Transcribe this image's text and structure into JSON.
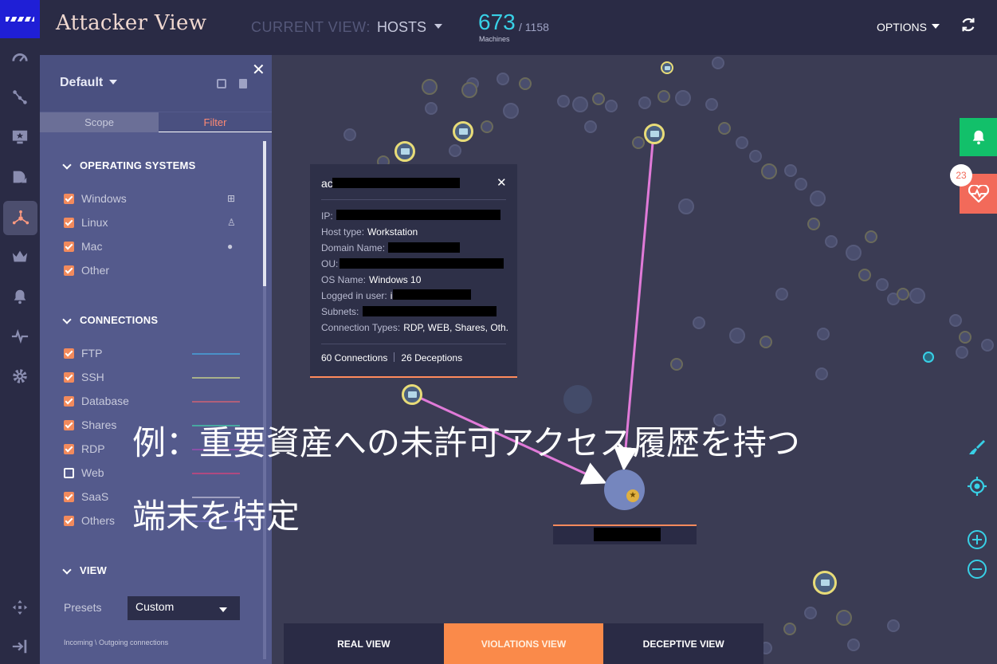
{
  "header": {
    "title": "Attacker View",
    "current_view_label": "CURRENT VIEW:",
    "current_view_value": "HOSTS",
    "machines_count": "673",
    "machines_total": "/ 1158",
    "machines_label": "Machines",
    "options_label": "OPTIONS"
  },
  "filter_panel": {
    "preset_name": "Default",
    "tabs": [
      "Scope",
      "Filter"
    ],
    "active_tab": "Filter",
    "operating_systems": {
      "title": "OPERATING SYSTEMS",
      "items": [
        {
          "label": "Windows",
          "checked": true,
          "icon": "windows-icon"
        },
        {
          "label": "Linux",
          "checked": true,
          "icon": "linux-icon"
        },
        {
          "label": "Mac",
          "checked": true,
          "icon": "apple-icon"
        },
        {
          "label": "Other",
          "checked": true
        }
      ]
    },
    "connections": {
      "title": "CONNECTIONS",
      "items": [
        {
          "label": "FTP",
          "checked": true,
          "color": "#4a90c8"
        },
        {
          "label": "SSH",
          "checked": true,
          "color": "#a8b08a"
        },
        {
          "label": "Database",
          "checked": true,
          "color": "#b0607a"
        },
        {
          "label": "Shares",
          "checked": true,
          "color": "#48a8a0"
        },
        {
          "label": "RDP",
          "checked": true,
          "color": "#8a50a8"
        },
        {
          "label": "Web",
          "checked": false,
          "color": "#b04a80"
        },
        {
          "label": "SaaS",
          "checked": true,
          "color": "#a0a0c0"
        },
        {
          "label": "Others",
          "checked": true,
          "color": "#6a6ab0"
        }
      ]
    },
    "view": {
      "title": "VIEW",
      "presets_label": "Presets",
      "presets_value": "Custom",
      "incoming_label": "Incoming \\ Outgoing connections"
    }
  },
  "popup": {
    "title_prefix": "ac",
    "rows": [
      {
        "label": "IP:",
        "value": ""
      },
      {
        "label": "Host type:",
        "value": "Workstation"
      },
      {
        "label": "Domain Name:",
        "value": ""
      },
      {
        "label": "OU:",
        "value": ""
      },
      {
        "label": "OS Name:",
        "value": "Windows 10"
      },
      {
        "label": "Logged in user:",
        "value": "i"
      },
      {
        "label": "Subnets:",
        "value": ""
      },
      {
        "label": "Connection Types:",
        "value": "RDP, WEB, Shares, Oth..."
      }
    ],
    "connections": "60 Connections",
    "deceptions": "26 Deceptions"
  },
  "overlay": {
    "line1": "例：重要資産への未許可アクセス履歴を持つ",
    "line2": "端末を特定"
  },
  "right_panel": {
    "alerts_badge": "23"
  },
  "bottom_tabs": [
    {
      "label": "REAL VIEW",
      "active": false
    },
    {
      "label": "VIOLATIONS VIEW",
      "active": true
    },
    {
      "label": "DECEPTIVE VIEW",
      "active": false
    }
  ],
  "colors": {
    "accent_orange": "#fa8a4a",
    "accent_cyan": "#38d0e6",
    "alert_green": "#12c06a",
    "health_red": "#f26a5a",
    "edge_pink": "#e07ad8"
  }
}
